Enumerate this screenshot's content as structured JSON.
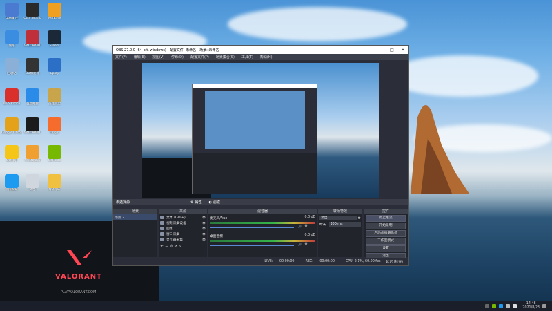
{
  "desktop": {
    "icons": [
      {
        "label": "电脑属性",
        "color": "#4a7bd0"
      },
      {
        "label": "OBS Studio",
        "color": "#2a2a2a"
      },
      {
        "label": "NetEase",
        "color": "#f0a020"
      },
      {
        "label": "网络",
        "color": "#3a8de0"
      },
      {
        "label": "VALORANT",
        "color": "#c0303a"
      },
      {
        "label": "Steam",
        "color": "#1b2838"
      },
      {
        "label": "回收站",
        "color": "#8ab0d8"
      },
      {
        "label": "UU加速器",
        "color": "#333"
      },
      {
        "label": "Uplay",
        "color": "#2b6fc7"
      },
      {
        "label": "WPS Office",
        "color": "#d9302c"
      },
      {
        "label": "百度网盘",
        "color": "#2a8be8"
      },
      {
        "label": "英雄联盟",
        "color": "#c8a44a"
      },
      {
        "label": "Google Chrome",
        "color": "#e3a21a"
      },
      {
        "label": "VALORANT",
        "color": "#1b1b1b"
      },
      {
        "label": "Origin",
        "color": "#f56c2d"
      },
      {
        "label": "QQ音乐",
        "color": "#f5c518"
      },
      {
        "label": "小鸡模拟器",
        "color": "#f0a030"
      },
      {
        "label": "GeForce",
        "color": "#76b900"
      },
      {
        "label": "腾讯QQ",
        "color": "#1d9bf0"
      },
      {
        "label": "文档",
        "color": "#cfd6de"
      },
      {
        "label": "QQ飞车",
        "color": "#f0c040"
      }
    ],
    "valorant_logo": "VALORANT",
    "valorant_url": "PLAYVALORANT.COM"
  },
  "obs": {
    "title": "OBS 27.0.0 (64-bit, windows) - 配置文件: 未命名 - 场景: 未命名",
    "menu": [
      "文件(F)",
      "编辑(E)",
      "视图(V)",
      "停靠(D)",
      "配置文件(P)",
      "场景集合(S)",
      "工具(T)",
      "帮助(H)"
    ],
    "scene_label": "未选择源",
    "ctrl_props": "属性",
    "ctrl_filters": "滤镜",
    "docks": {
      "scenes": "场景",
      "sources": "来源",
      "mixer": "混音器",
      "transitions": "转场特效",
      "controls": "控件"
    },
    "scenes_list": [
      "场景 2"
    ],
    "sources_list": [
      "文本 (GDI+)",
      "视频采集设备",
      "图像",
      "窗口采集",
      "显示器采集"
    ],
    "mixer_tracks": [
      {
        "name": "麦克风/Aux",
        "db": "0.0 dB"
      },
      {
        "name": "桌面音频",
        "db": "0.0 dB"
      }
    ],
    "transition_type": "淡出",
    "transition_duration_label": "时长",
    "transition_duration": "300 ms",
    "controls": [
      "停止推流",
      "开始录制",
      "启动虚拟摄像机",
      "工作室模式",
      "设置",
      "退出"
    ],
    "status": {
      "live_label": "LIVE:",
      "live_time": "00:00:00",
      "rec_label": "REC:",
      "rec_time": "00:00:00",
      "cpu": "CPU: 2.1%, 60.00 fps",
      "extra": "延迟 (检查)"
    }
  },
  "taskbar": {
    "time": "14:48",
    "date": "2021/8/23"
  }
}
